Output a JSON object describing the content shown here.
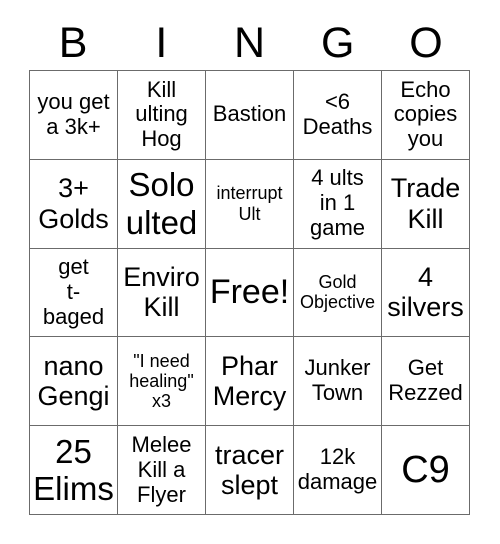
{
  "card": {
    "title_letters": [
      "B",
      "I",
      "N",
      "G",
      "O"
    ],
    "rows": [
      [
        {
          "text": "you get\na 3k+",
          "size": "md"
        },
        {
          "text": "Kill\nulting\nHog",
          "size": "md"
        },
        {
          "text": "Bastion",
          "size": "md"
        },
        {
          "text": "<6\nDeaths",
          "size": "md"
        },
        {
          "text": "Echo\ncopies\nyou",
          "size": "md"
        }
      ],
      [
        {
          "text": "3+\nGolds",
          "size": "lg"
        },
        {
          "text": "Solo\nulted",
          "size": "xl"
        },
        {
          "text": "interrupt\nUlt",
          "size": "sm"
        },
        {
          "text": "4 ults\nin 1\ngame",
          "size": "md"
        },
        {
          "text": "Trade\nKill",
          "size": "lg"
        }
      ],
      [
        {
          "text": "get\nt-\nbaged",
          "size": "md"
        },
        {
          "text": "Enviro\nKill",
          "size": "lg"
        },
        {
          "text": "Free!",
          "size": "free"
        },
        {
          "text": "Gold\nObjective",
          "size": "sm"
        },
        {
          "text": "4\nsilvers",
          "size": "lg"
        }
      ],
      [
        {
          "text": "nano\nGengi",
          "size": "lg"
        },
        {
          "text": "\"I need\nhealing\"\nx3",
          "size": "sm"
        },
        {
          "text": "Phar\nMercy",
          "size": "lg"
        },
        {
          "text": "Junker\nTown",
          "size": "md"
        },
        {
          "text": "Get\nRezzed",
          "size": "md"
        }
      ],
      [
        {
          "text": "25\nElims",
          "size": "xl"
        },
        {
          "text": "Melee\nKill a\nFlyer",
          "size": "md"
        },
        {
          "text": "tracer\nslept",
          "size": "lg"
        },
        {
          "text": "12k\ndamage",
          "size": "md"
        },
        {
          "text": "C9",
          "size": "c9"
        }
      ]
    ]
  },
  "colors": {
    "background": "#ffffff",
    "text": "#000000",
    "grid_line": "#6b6b6b"
  }
}
